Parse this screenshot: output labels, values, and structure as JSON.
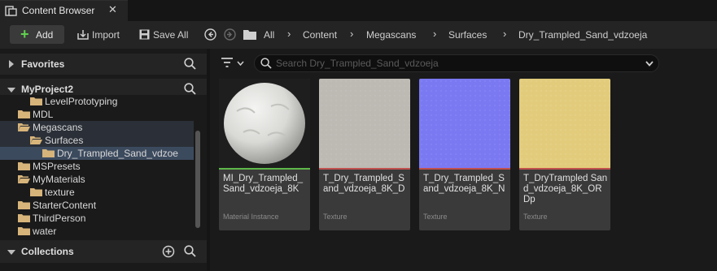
{
  "window": {
    "tab_title": "Content Browser",
    "close": "✕"
  },
  "toolbar": {
    "add_label": "Add",
    "import_label": "Import",
    "saveall_label": "Save All",
    "breadcrumbs": [
      "All",
      "Content",
      "Megascans",
      "Surfaces",
      "Dry_Trampled_Sand_vdzoeja"
    ]
  },
  "sidebar": {
    "favorites_title": "Favorites",
    "project_title": "MyProject2",
    "collections_title": "Collections",
    "tree": [
      {
        "label": "LevelPrototyping",
        "depth": 2,
        "expanded": false,
        "open_folder": false,
        "state": ""
      },
      {
        "label": "MDL",
        "depth": 1,
        "expanded": false,
        "open_folder": false,
        "state": ""
      },
      {
        "label": "Megascans",
        "depth": 1,
        "expanded": true,
        "open_folder": true,
        "state": "parent"
      },
      {
        "label": "Surfaces",
        "depth": 2,
        "expanded": true,
        "open_folder": true,
        "state": "parent"
      },
      {
        "label": "Dry_Trampled_Sand_vdzoe",
        "depth": 3,
        "expanded": null,
        "open_folder": false,
        "state": "selected"
      },
      {
        "label": "MSPresets",
        "depth": 1,
        "expanded": false,
        "open_folder": false,
        "state": ""
      },
      {
        "label": "MyMaterials",
        "depth": 1,
        "expanded": true,
        "open_folder": true,
        "state": ""
      },
      {
        "label": "texture",
        "depth": 2,
        "expanded": null,
        "open_folder": false,
        "state": ""
      },
      {
        "label": "StarterContent",
        "depth": 1,
        "expanded": false,
        "open_folder": false,
        "state": ""
      },
      {
        "label": "ThirdPerson",
        "depth": 1,
        "expanded": false,
        "open_folder": false,
        "state": ""
      },
      {
        "label": "water",
        "depth": 1,
        "expanded": null,
        "open_folder": false,
        "state": ""
      }
    ]
  },
  "search": {
    "placeholder": "Search Dry_Trampled_Sand_vdzoeja"
  },
  "assets": [
    {
      "name": "MI_Dry_Trampled_Sand_vdzoeja_8K",
      "type": "Material Instance",
      "thumb": "sphere",
      "bar_color": "#5eb84a"
    },
    {
      "name": "T_Dry_Trampled_Sand_vdzoeja_8K_D",
      "type": "Texture",
      "thumb": "#bdb9b3",
      "bar_color": "#c0504d"
    },
    {
      "name": "T_Dry_Trampled_Sand_vdzoeja_8K_N",
      "type": "Texture",
      "thumb": "#7b79f2",
      "bar_color": "#c0504d"
    },
    {
      "name": "T_DryTrampled Sand_vdzoeja_8K_ORDp",
      "type": "Texture",
      "thumb": "#e2cc7c",
      "bar_color": "#c0504d"
    }
  ],
  "colors": {
    "add_plus": "#5fd14e",
    "selected_row": "#3c4a5e"
  },
  "icons": [
    "content-browser-icon",
    "close-icon",
    "plus-icon",
    "import-icon",
    "save-icon",
    "back-icon",
    "forward-icon",
    "folder-icon",
    "search-icon",
    "filter-icon",
    "chevron-down-icon",
    "add-circle-icon"
  ]
}
